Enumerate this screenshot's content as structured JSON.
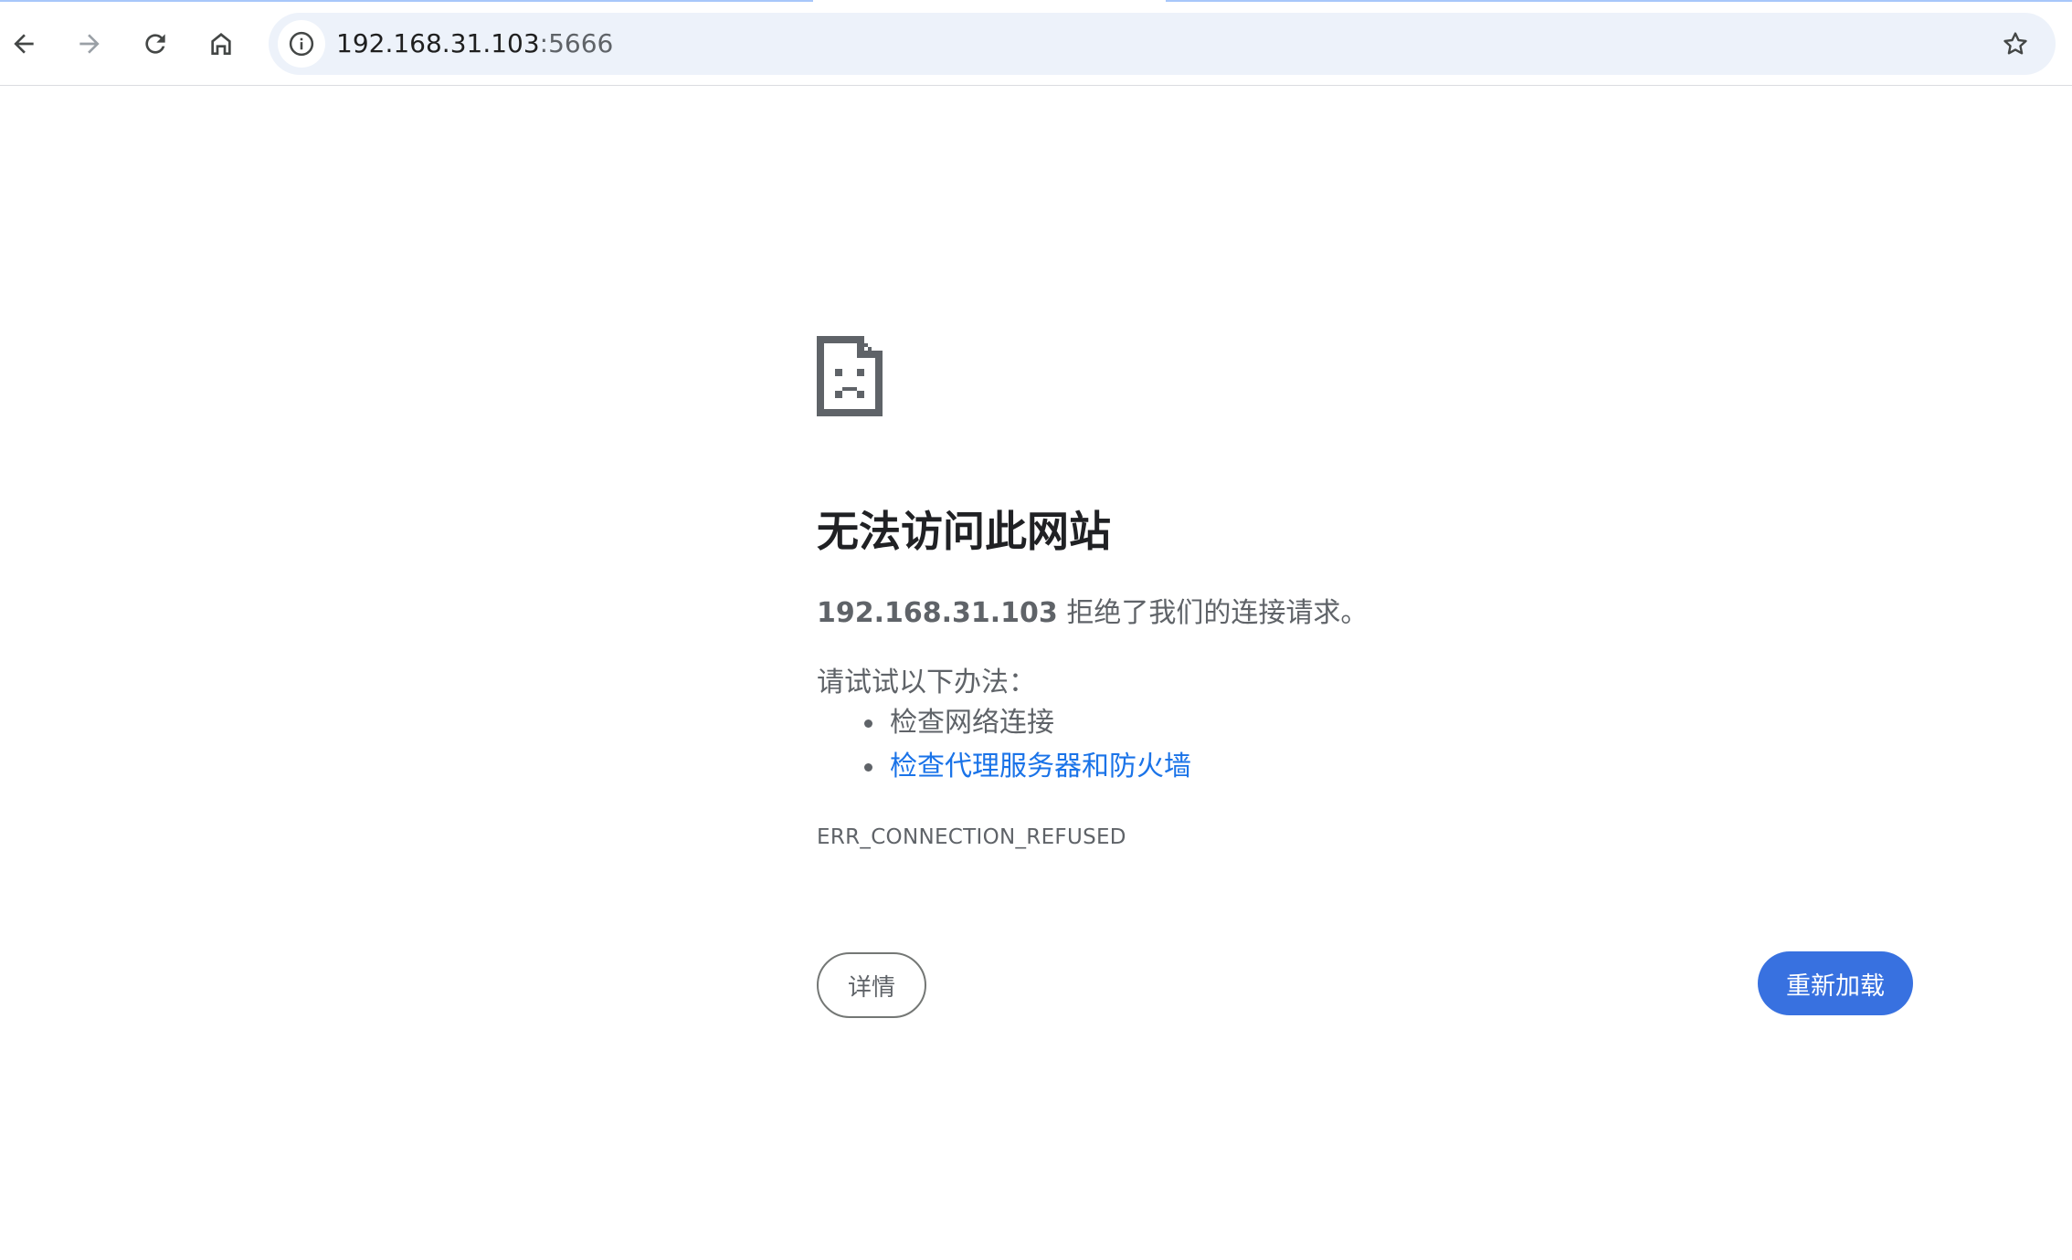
{
  "browser": {
    "address_bar": {
      "host": "192.168.31.103",
      "port": ":5666",
      "info_icon": "info-icon",
      "bookmark_icon": "star-icon"
    },
    "nav_icons": [
      "back-arrow-icon",
      "forward-arrow-icon",
      "reload-icon",
      "home-icon"
    ]
  },
  "error_page": {
    "icon": "sad-page-icon",
    "title": "无法访问此网站",
    "summary_host": "192.168.31.103",
    "summary_text": " 拒绝了我们的连接请求。",
    "suggestions_heading": "请试试以下办法：",
    "suggestions": [
      {
        "label": "检查网络连接",
        "is_link": false
      },
      {
        "label": "检查代理服务器和防火墙",
        "is_link": true
      }
    ],
    "error_code": "ERR_CONNECTION_REFUSED",
    "details_button": "详情",
    "reload_button": "重新加载"
  },
  "colors": {
    "accent": "#3871e0",
    "link": "#1a73e8",
    "text_secondary": "#5f6368",
    "omnibox_bg": "#edf2fa"
  }
}
